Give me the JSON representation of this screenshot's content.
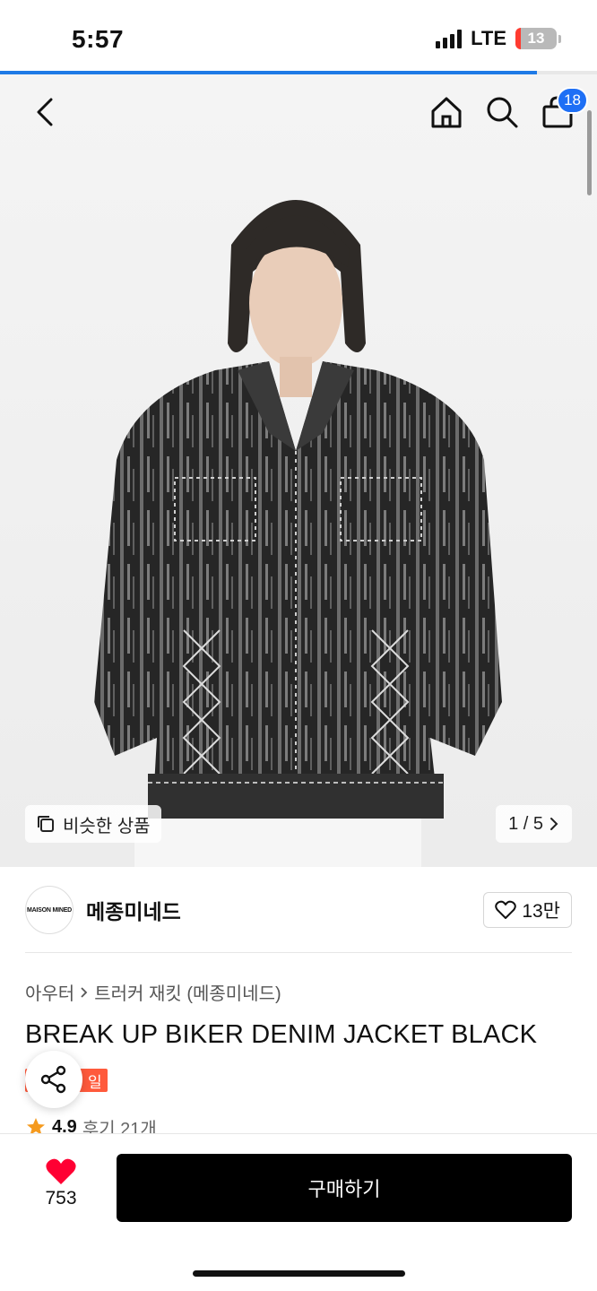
{
  "status_bar": {
    "time": "5:57",
    "network": "LTE",
    "battery": "13",
    "battery_level": 0.13
  },
  "page_progress": 0.9,
  "nav": {
    "back_icon": "chevron-left-icon",
    "home_icon": "home-icon",
    "search_icon": "search-icon",
    "cart_icon": "shopping-bag-icon",
    "cart_count": "18"
  },
  "gallery": {
    "similar_label": "비슷한 상품",
    "page_indicator": "1 / 5"
  },
  "brand": {
    "logo_text": "MAISON MINED",
    "name": "메종미네드",
    "likes": "13만"
  },
  "product": {
    "breadcrumb": [
      "아우터",
      "트러커 재킷 (메종미네드)"
    ],
    "title": "BREAK UP BIKER DENIM JACKET BLACK",
    "badge": "일",
    "rating": "4.9",
    "reviews": "후기 21개"
  },
  "bottom_bar": {
    "wish_count": "753",
    "buy_label": "구매하기"
  },
  "colors": {
    "accent": "#1e6ff5",
    "badge": "#ff5a3c",
    "heart": "#ff0033",
    "star": "#f59a1e"
  }
}
